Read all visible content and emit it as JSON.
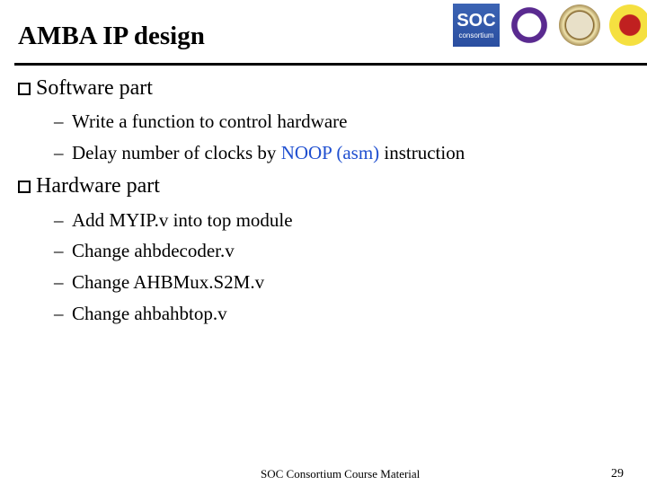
{
  "title": "AMBA IP design",
  "logos": {
    "soc": "SOC",
    "soc_sub": "consortium"
  },
  "sections": [
    {
      "label": "Software part",
      "items": [
        {
          "text": "Write a function to control hardware"
        },
        {
          "pre": "Delay number of clocks by ",
          "highlight": "NOOP (asm)",
          "post": " instruction"
        }
      ]
    },
    {
      "label": "Hardware part",
      "items": [
        {
          "text": "Add MYIP.v into top module"
        },
        {
          "text": "Change ahbdecoder.v"
        },
        {
          "text": "Change AHBMux.S2M.v"
        },
        {
          "text": "Change ahbahbtop.v"
        }
      ]
    }
  ],
  "bullet_dash": "–",
  "highlight_color": "#1f4fd0",
  "footer": "SOC Consortium Course Material",
  "page_number": "29"
}
